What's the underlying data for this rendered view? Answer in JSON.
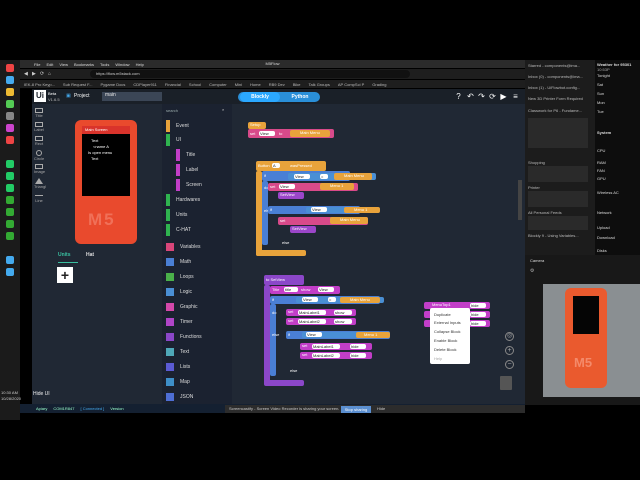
{
  "browser": {
    "window_title": "M5Flow",
    "menu": [
      "File",
      "Edit",
      "View",
      "Bookmarks",
      "Tools",
      "Window",
      "Help"
    ],
    "url": "https://flow.m5stack.com",
    "bookmarks": [
      "IEK-8 Pro Keyp...",
      "Sub Request F...",
      "Pygame Docs",
      "CDPlayer911",
      "Financial",
      "School",
      "Computer",
      "Mini",
      "Home",
      "RB9 Dev",
      "Bike",
      "Talk Groups",
      "AP CompSci P",
      "Grading"
    ]
  },
  "app": {
    "logo": "Ui",
    "beta": "Beta",
    "version": "V1.6.5",
    "project_label": "Project",
    "search_value": "main",
    "mode_blockly": "Blockly",
    "mode_python": "Python",
    "sidebar_icons": [
      "Title",
      "Label",
      "Rect",
      "Circle",
      "Image",
      "Triangle",
      "Line"
    ],
    "device": {
      "screen_title": "Main Screen",
      "lines": [
        "Text",
        "<name A",
        "Is open menu",
        "Text"
      ],
      "logo": "M5"
    },
    "units_tab": "Units",
    "hat_tab": "Hat",
    "hide_ui": "Hide UI",
    "search_placeholder": "search"
  },
  "categories": [
    {
      "label": "Event",
      "color": "#e8a33b"
    },
    {
      "label": "UI",
      "color": "#2fb34f"
    },
    {
      "label": "Title",
      "color": "#c23ec8"
    },
    {
      "label": "Label",
      "color": "#c23ec8"
    },
    {
      "label": "Screen",
      "color": "#c23ec8"
    },
    {
      "label": "Hardwares",
      "color": "#2fb34f"
    },
    {
      "label": "Units",
      "color": "#2fb34f"
    },
    {
      "label": "C-HAT",
      "color": "#2fb34f"
    },
    {
      "label": "Variables",
      "color": "#d9467a"
    },
    {
      "label": "Math",
      "color": "#4a7fd4"
    },
    {
      "label": "Loops",
      "color": "#4ab04a"
    },
    {
      "label": "Logic",
      "color": "#4a8fd4"
    },
    {
      "label": "Graphic",
      "color": "#d448aa"
    },
    {
      "label": "Timer",
      "color": "#b045c8"
    },
    {
      "label": "Functions",
      "color": "#8b47c9"
    },
    {
      "label": "Text",
      "color": "#4fa8b8"
    },
    {
      "label": "Lists",
      "color": "#5b5bd4"
    },
    {
      "label": "Map",
      "color": "#3e8fc8"
    },
    {
      "label": "JSON",
      "color": "#4e6ed4"
    }
  ],
  "blocks": {
    "setup_label": "Setup",
    "set_text": "set",
    "to_text": "to",
    "view_var": "View",
    "main_menu": "Main Menu",
    "btn_label": "Button",
    "was_pressed": "wasPressed",
    "if_text": "if",
    "do_text": "do",
    "else_text": "else",
    "menu1": "Menu 1",
    "set_view": "SetView",
    "to_setview": "to SetView",
    "title_label": "Title",
    "show_text": "show",
    "main_label1": "MainLabel1",
    "main_label2": "MainLabel2",
    "hide_text": "hide",
    "menu_top1": "MenuTop1",
    "eq": "="
  },
  "context_menu": [
    "Duplicate",
    "External Inputs",
    "Collapse Block",
    "Enable Block",
    "Delete Block",
    "Help"
  ],
  "status": {
    "items": [
      "Apiary",
      "COM1R847",
      "[ Connected ]",
      "Version"
    ],
    "share_text": "Screencastify - Screen Video Recorder is sharing your screen.",
    "stop_sharing": "Stop sharing",
    "hide": "Hide"
  },
  "right_browser": {
    "items": [
      "Starred - components@ima...",
      "Inbox (0) - components@ima...",
      "Inbox (1) - UiFlowbot.config...",
      "New 3D Printer Form Required",
      "Classwork for P6 - Fundame...",
      "Shopping",
      "Printer",
      "All Personal Feeds",
      "Blockly 9 - Using Variables..."
    ],
    "camera_label": "Camera"
  },
  "system": {
    "weather_title": "Weather for 95301",
    "weather_sub": "10:53P",
    "lines": [
      "Tonight",
      "Sat",
      "Sun",
      "Mon",
      "Tue",
      "System",
      "CPU",
      "RAM",
      "FAN",
      "GPU",
      "Wireless AC",
      "Network",
      "Upload",
      "Download",
      "Disks"
    ],
    "clock": "10:30 AM",
    "date": "10/28/2020"
  }
}
